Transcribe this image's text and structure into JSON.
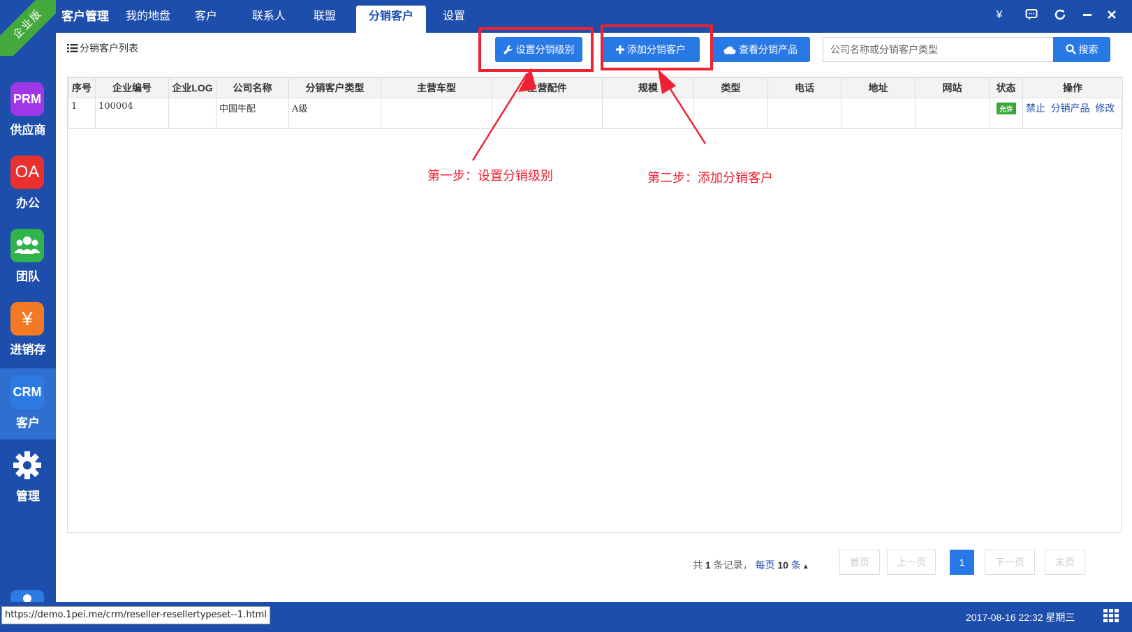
{
  "edition_label": "企业版",
  "sidebar": {
    "items": [
      {
        "icon_text": "PRM",
        "label": "供应商",
        "color": "#a037e6",
        "icon": "prm-icon"
      },
      {
        "icon_text": "OA",
        "label": "办公",
        "color": "#e8312f",
        "icon": "oa-icon"
      },
      {
        "icon_text": "",
        "label": "团队",
        "color": "#2fb34a",
        "icon": "team-icon"
      },
      {
        "icon_text": "¥",
        "label": "进销存",
        "color": "#f27a24",
        "icon": "yen-icon"
      },
      {
        "icon_text": "CRM",
        "label": "客户",
        "color": "#2c7be5",
        "icon": "crm-icon"
      },
      {
        "icon_text": "",
        "label": "管理",
        "color": "",
        "icon": "gear-icon"
      }
    ]
  },
  "topnav": {
    "tabs": [
      "客户管理",
      "我的地盘",
      "客户",
      "联系人",
      "联盟",
      "分销客户",
      "设置"
    ],
    "active": "分销客户",
    "controls": [
      "¥",
      "chat-icon",
      "refresh-icon",
      "minimize-icon",
      "close-icon"
    ]
  },
  "toolbar": {
    "list_title": "分销客户列表",
    "btn_set_level": "设置分销级别",
    "btn_add_customer": "添加分销客户",
    "btn_view_products": "查看分销产品",
    "search_placeholder": "公司名称或分销客户类型",
    "search_label": "搜索"
  },
  "table": {
    "headers": [
      "序号",
      "企业编号",
      "企业LOG",
      "公司名称",
      "分销客户类型",
      "主营车型",
      "主营配件",
      "规模",
      "类型",
      "电话",
      "地址",
      "网站",
      "状态",
      "操作"
    ],
    "rows": [
      {
        "index": "1",
        "code": "100004",
        "logo": "",
        "company": "中国牛配",
        "type": "A级",
        "status": "允许",
        "ops": [
          "禁止",
          "分销产品",
          "修改"
        ]
      }
    ]
  },
  "annotations": {
    "step1": "第一步：设置分销级别",
    "step2": "第二步：添加分销客户"
  },
  "pagination": {
    "prefix": "共",
    "total": "1",
    "suffix": "条记录，",
    "per_page_prefix": "每页",
    "per_page": "10",
    "per_page_suffix": "条",
    "first": "首页",
    "prev": "上一页",
    "current": "1",
    "next": "下一页",
    "last": "末页"
  },
  "statusbar": {
    "url": "https://demo.1pei.me/crm/reseller-resellertypeset--1.html",
    "clock": "2017-08-16 22:32 星期三"
  },
  "colors": {
    "primary": "#1d4eab",
    "button": "#2878e5",
    "annotation": "#ee2233",
    "status_allow": "#3aa53a"
  }
}
